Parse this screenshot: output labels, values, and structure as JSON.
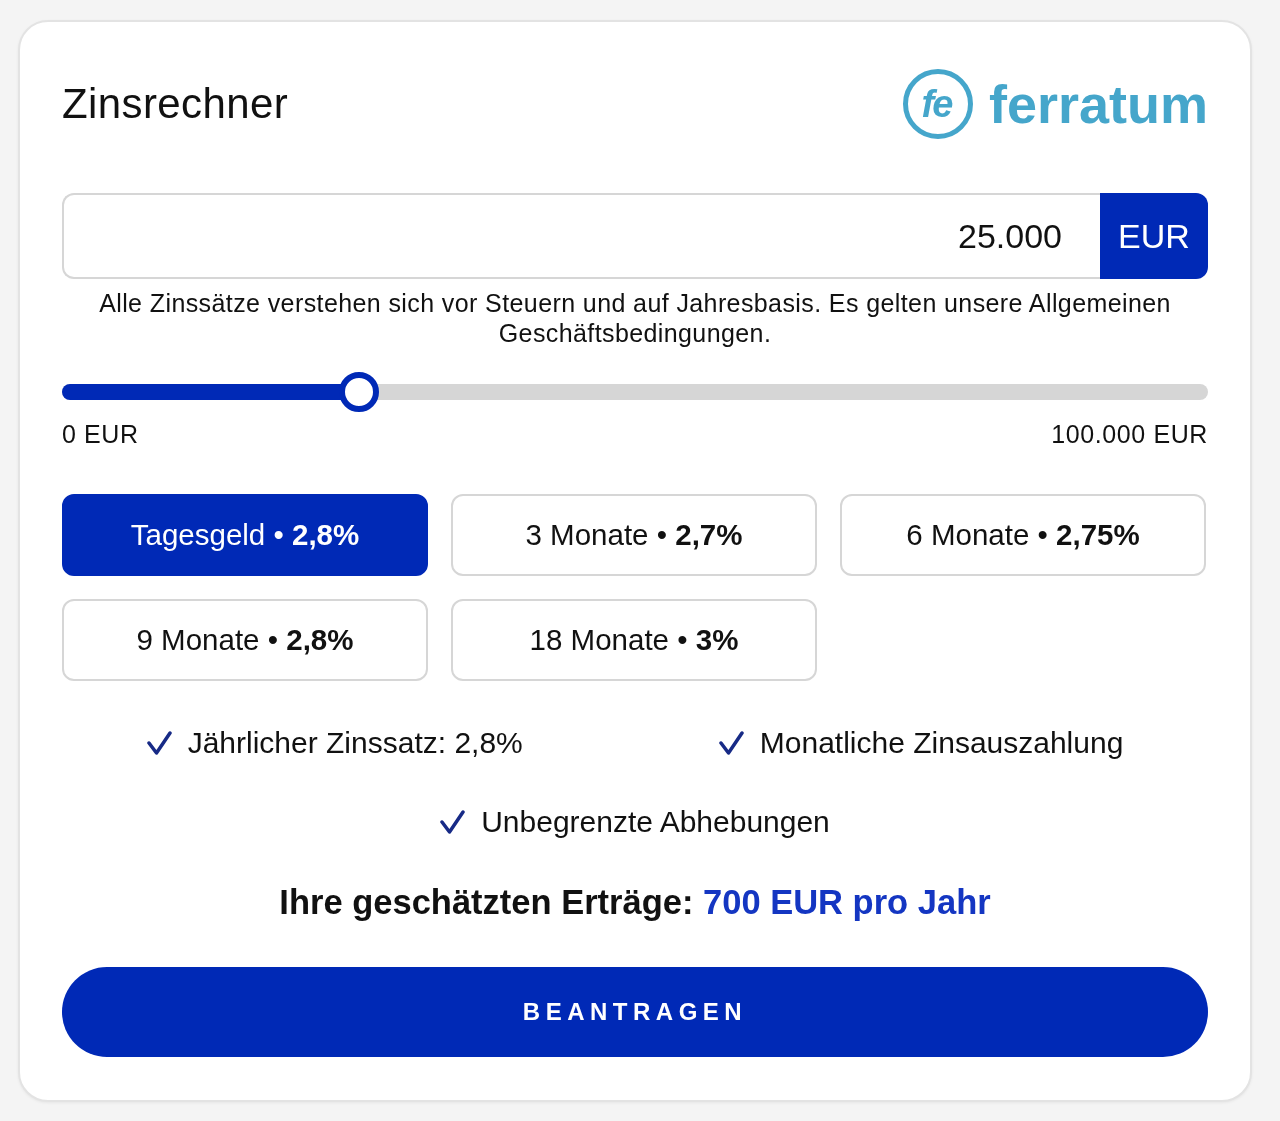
{
  "header": {
    "title": "Zinsrechner",
    "logo": {
      "mark": "fe",
      "name": "ferratum"
    }
  },
  "amount": {
    "value": "25.000",
    "currency": "EUR"
  },
  "disclaimer": "Alle Zinssätze verstehen sich vor Steuern und auf Jahresbasis. Es gelten unsere Allgemeinen Geschäftsbedingungen.",
  "slider": {
    "level": 0.25,
    "min_label": "0 EUR",
    "max_label": "100.000 EUR"
  },
  "options": [
    {
      "label": "Tagesgeld • **2,8%**",
      "selected": true
    },
    {
      "label": "3 Monate • **2,7%**",
      "selected": false
    },
    {
      "label": "6 Monate • **2,75%**",
      "selected": false
    },
    {
      "label": "9 Monate • **2,8%**",
      "selected": false
    },
    {
      "label": "18 Monate • **3%**",
      "selected": false
    }
  ],
  "features": [
    "Jährlicher Zinssatz: 2,8%",
    "Monatliche Zinsauszahlung",
    "Unbegrenzte Abhebungen"
  ],
  "earnings": {
    "label": "Ihre geschätzten Erträge:",
    "value": "700 EUR pro Jahr"
  },
  "submit_button": "BEANTRAGEN"
}
